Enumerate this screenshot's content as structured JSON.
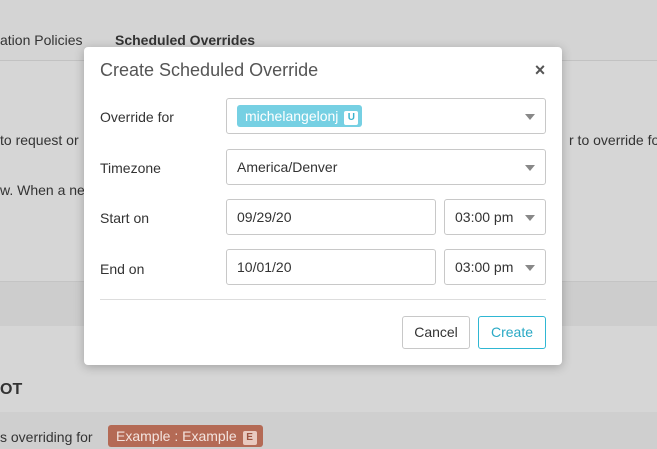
{
  "background": {
    "tabs": [
      "ation Policies",
      "Scheduled Overrides"
    ],
    "text_left_1": "to request or",
    "text_right_1": "r to override fo",
    "text_left_2": "w. When a new",
    "heading": "OT",
    "row_text": "s overriding for",
    "badge_label": "Example : Example",
    "badge_mini": "E"
  },
  "modal": {
    "title": "Create Scheduled Override",
    "close_glyph": "×",
    "fields": {
      "override_for": {
        "label": "Override for",
        "chip": "michelangelonj",
        "chip_mini": "U"
      },
      "timezone": {
        "label": "Timezone",
        "value": "America/Denver"
      },
      "start_on": {
        "label": "Start on",
        "date": "09/29/20",
        "time": "03:00 pm"
      },
      "end_on": {
        "label": "End on",
        "date": "10/01/20",
        "time": "03:00 pm"
      }
    },
    "buttons": {
      "cancel": "Cancel",
      "create": "Create"
    }
  },
  "colors": {
    "accent": "#2fb7d3",
    "chip_bg": "#76d0e3",
    "badge_bg": "#b46a55"
  }
}
